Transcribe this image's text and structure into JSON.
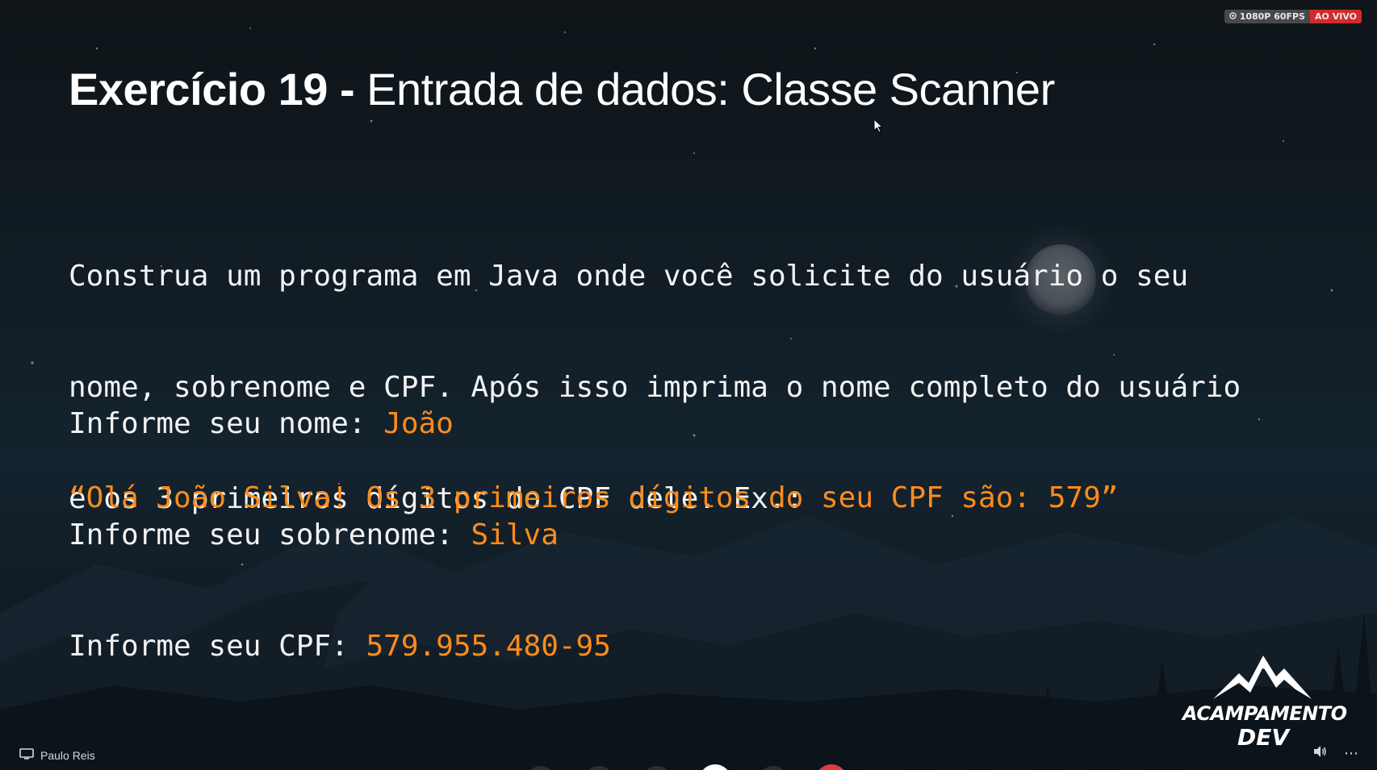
{
  "slide": {
    "title_bold": "Exercício 19 -",
    "title_rest": "Entrada de dados: Classe Scanner",
    "instructions": [
      "Construa um programa em Java onde você solicite do usuário o seu",
      "nome, sobrenome e CPF. Após isso imprima o nome completo do usuário",
      "e os 3 primeiros dígitos do CPF dele. Ex.:"
    ],
    "example": [
      {
        "prompt": "Informe seu nome: ",
        "value": "João"
      },
      {
        "prompt": "Informe seu sobrenome: ",
        "value": "Silva"
      },
      {
        "prompt": "Informe seu CPF: ",
        "value": "579.955.480-95"
      }
    ],
    "result": "“Olá João Silva! Os 3 primeiros dígitos do seu CPF são: 579”"
  },
  "stream": {
    "quality": "1080P 60FPS",
    "live_label": "AO VIVO",
    "presenter": "Paulo Reis"
  },
  "logo": {
    "line1": "ACAMPAMENTO",
    "line2": "DEV"
  },
  "colors": {
    "accent": "#ff8c1a",
    "text": "#f2f2f2",
    "live": "#d32b2b"
  },
  "icons": [
    "screen-share-icon",
    "speaker-icon",
    "more-icon",
    "camera-icon",
    "cursor-icon"
  ]
}
